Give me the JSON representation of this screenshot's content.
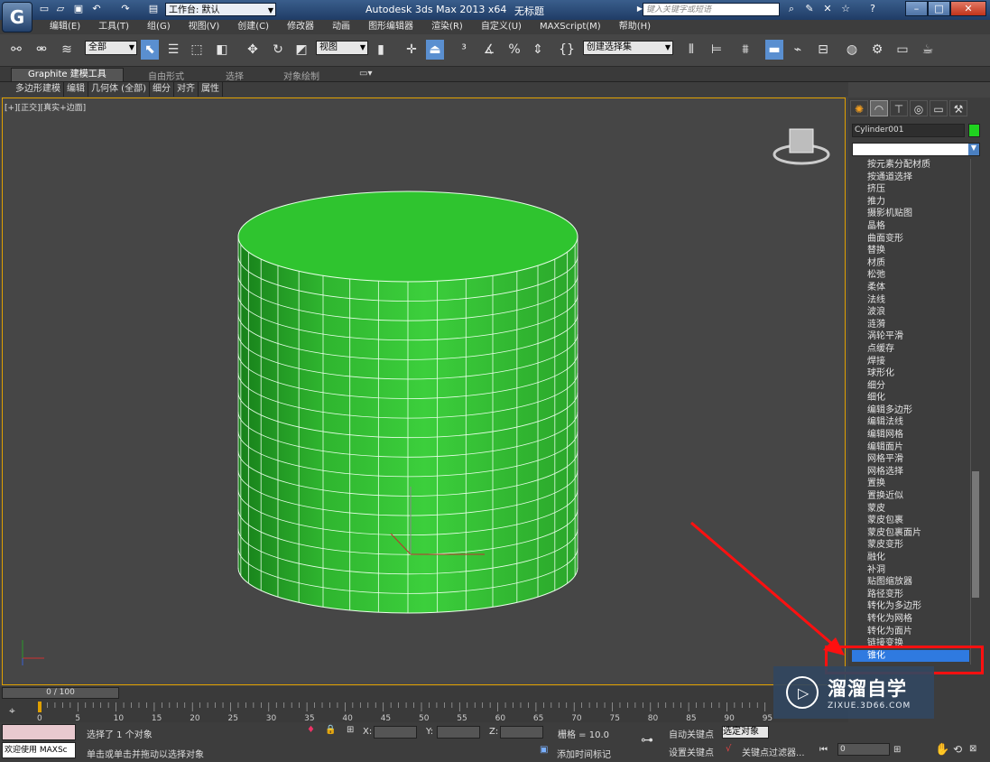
{
  "title_bar": {
    "logo": "G",
    "workspace_label": "工作台: 默认",
    "app_title": "Autodesk 3ds Max  2013 x64",
    "doc_title": "无标题",
    "search_placeholder": "键入关键字或短语"
  },
  "menu": [
    "编辑(E)",
    "工具(T)",
    "组(G)",
    "视图(V)",
    "创建(C)",
    "修改器",
    "动画",
    "图形编辑器",
    "渲染(R)",
    "自定义(U)",
    "MAXScript(M)",
    "帮助(H)"
  ],
  "toolbar": {
    "selection_filter": "全部",
    "ref_coord": "视图",
    "named_selection": "创建选择集"
  },
  "ribbon": {
    "tabs": [
      "Graphite 建模工具",
      "自由形式",
      "选择",
      "对象绘制"
    ],
    "subtabs": [
      "多边形建模",
      "编辑",
      "几何体 (全部)",
      "细分",
      "对齐",
      "属性"
    ]
  },
  "viewport": {
    "label": "[+][正交][真实+边面]",
    "object_color": "#2fc42f"
  },
  "command_panel": {
    "object_name": "Cylinder001",
    "object_color": "#1fd21f",
    "modifier_list": [
      "按元素分配材质",
      "按通道选择",
      "挤压",
      "推力",
      "摄影机贴图",
      "晶格",
      "曲面变形",
      "替换",
      "材质",
      "松弛",
      "柔体",
      "法线",
      "波浪",
      "涟漪",
      "涡轮平滑",
      "点缓存",
      "焊接",
      "球形化",
      "细分",
      "细化",
      "编辑多边形",
      "编辑法线",
      "编辑网格",
      "编辑面片",
      "网格平滑",
      "网格选择",
      "置换",
      "置换近似",
      "蒙皮",
      "蒙皮包裹",
      "蒙皮包裹面片",
      "蒙皮变形",
      "融化",
      "补洞",
      "贴图缩放器",
      "路径变形",
      "转化为多边形",
      "转化为网格",
      "转化为面片",
      "链接变换",
      "锥化"
    ],
    "selected_modifier": "锥化"
  },
  "timeline": {
    "slider": "0 / 100",
    "ticks": [
      "0",
      "5",
      "10",
      "15",
      "20",
      "25",
      "30",
      "35",
      "40",
      "45",
      "50",
      "55",
      "60",
      "65",
      "70",
      "75",
      "80",
      "85",
      "90",
      "95"
    ]
  },
  "status": {
    "selected_msg": "选择了 1 个对象",
    "prompt_msg": "单击或单击并拖动以选择对象",
    "maxscript": "欢迎使用 MAXSc",
    "x_label": "X:",
    "y_label": "Y:",
    "z_label": "Z:",
    "grid": "栅格 = 10.0",
    "auto_key": "自动关键点",
    "selected_object": "选定对象",
    "set_key": "设置关键点",
    "key_filter": "关键点过滤器...",
    "add_time_tag": "添加时间标记",
    "frame": "0"
  },
  "watermark": {
    "main": "溜溜自学",
    "sub": "ZIXUE.3D66.COM"
  }
}
